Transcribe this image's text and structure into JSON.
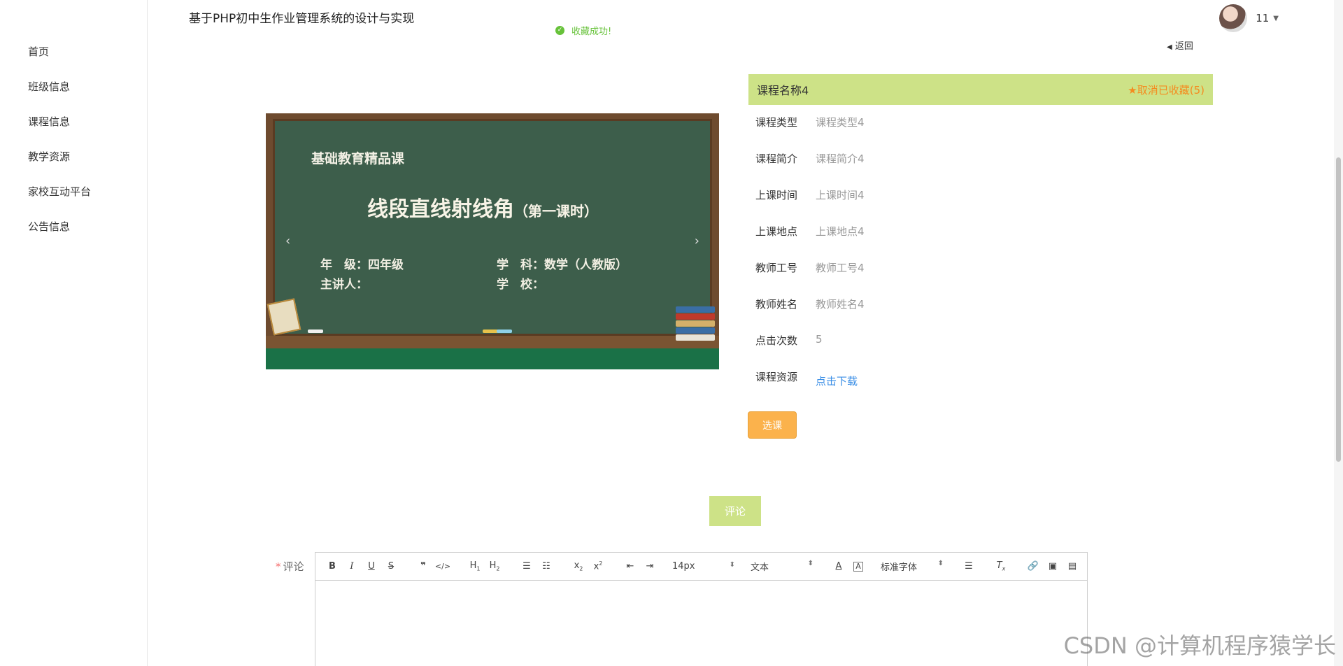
{
  "header": {
    "title": "基于PHP初中生作业管理系统的设计与实现",
    "user_name": "11",
    "toast": "收藏成功!"
  },
  "sidebar": {
    "items": [
      {
        "label": "首页"
      },
      {
        "label": "班级信息"
      },
      {
        "label": "课程信息"
      },
      {
        "label": "教学资源"
      },
      {
        "label": "家校互动平台"
      },
      {
        "label": "公告信息"
      }
    ]
  },
  "back_label": "返回",
  "banner": {
    "small_title": "基础教育精品课",
    "main_title": "线段直线射线角",
    "main_sub": "（第一课时）",
    "grade": "年　级：四年级",
    "subject": "学　科：数学（人教版）",
    "lecturer": "主讲人：",
    "school": "学　校："
  },
  "course": {
    "name": "课程名称4",
    "fav_label": "取消已收藏(5)",
    "fields": [
      {
        "label": "课程类型",
        "value": "课程类型4"
      },
      {
        "label": "课程简介",
        "value": "课程简介4"
      },
      {
        "label": "上课时间",
        "value": "上课时间4"
      },
      {
        "label": "上课地点",
        "value": "上课地点4"
      },
      {
        "label": "教师工号",
        "value": "教师工号4"
      },
      {
        "label": "教师姓名",
        "value": "教师姓名4"
      },
      {
        "label": "点击次数",
        "value": "5"
      },
      {
        "label": "课程资源",
        "value": "点击下载"
      }
    ],
    "select_label": "选课"
  },
  "comment": {
    "button_label": "评论",
    "field_label": "评论",
    "toolbar": {
      "font_size": "14px",
      "text_style": "文本",
      "font_family": "标准字体"
    }
  },
  "watermark": "CSDN @计算机程序猿学长",
  "colors": {
    "accent": "#cde287",
    "orange": "#fbb24c",
    "success": "#67c23a",
    "link": "#3a8ee6"
  }
}
